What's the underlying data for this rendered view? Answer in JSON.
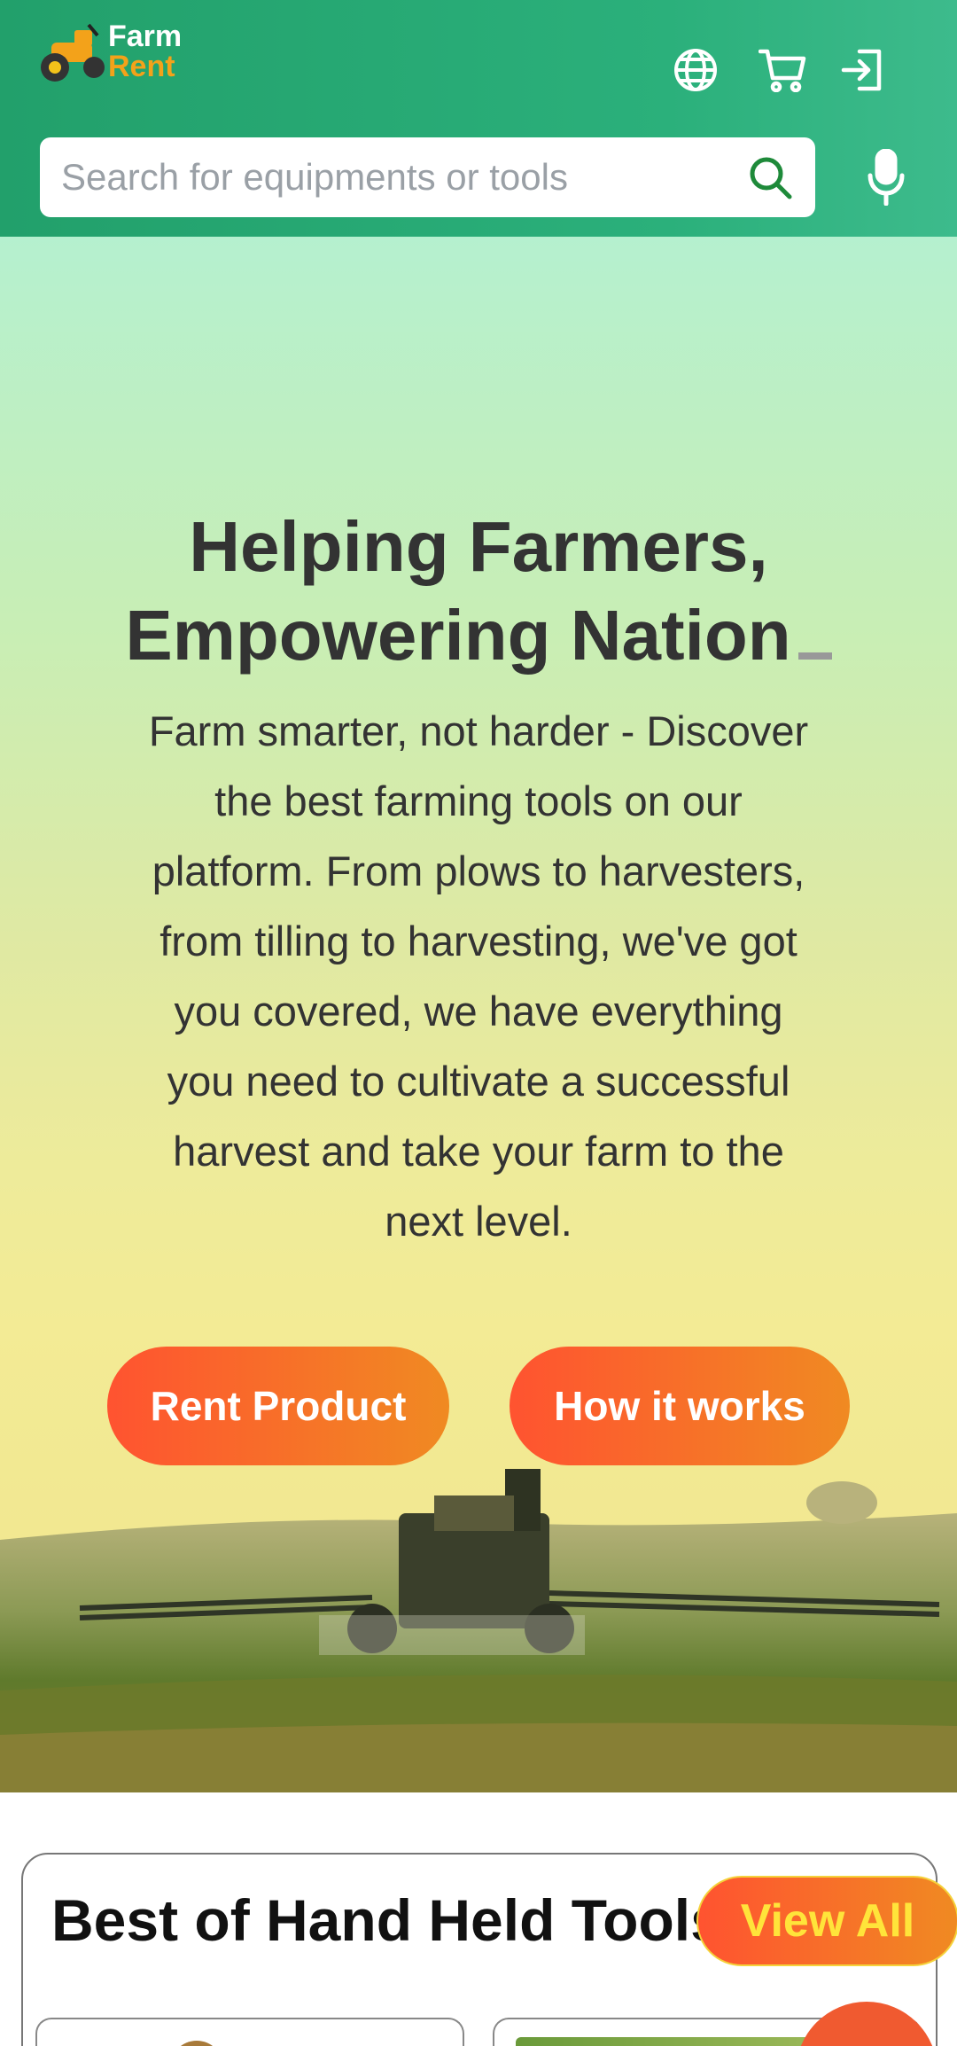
{
  "header": {
    "logo": {
      "line1": "Farm",
      "line2": "Rent",
      "icon": "tractor-icon"
    },
    "icons": [
      "globe-icon",
      "cart-icon",
      "login-icon"
    ],
    "search": {
      "placeholder": "Search for equipments or tools",
      "value": ""
    },
    "mic_icon": "microphone-icon",
    "colors": {
      "bar": "#22a06b",
      "logo_accent": "#f3a21a"
    }
  },
  "hero": {
    "title_line1": "Helping Farmers,",
    "title_line2": "Empowering Nation",
    "description": "Farm smarter, not harder - Discover the best farming tools on our platform. From plows to harvesters, from tilling to harvesting, we've got you covered, we have everything you need to cultivate a successful harvest and take your farm to the next level.",
    "buttons": {
      "rent": "Rent Product",
      "how": "How it works"
    },
    "colors": {
      "button_start": "#ff5330",
      "button_end": "#f08a22"
    }
  },
  "section": {
    "title": "Best of Hand Held Tools",
    "view_all": "View All"
  }
}
